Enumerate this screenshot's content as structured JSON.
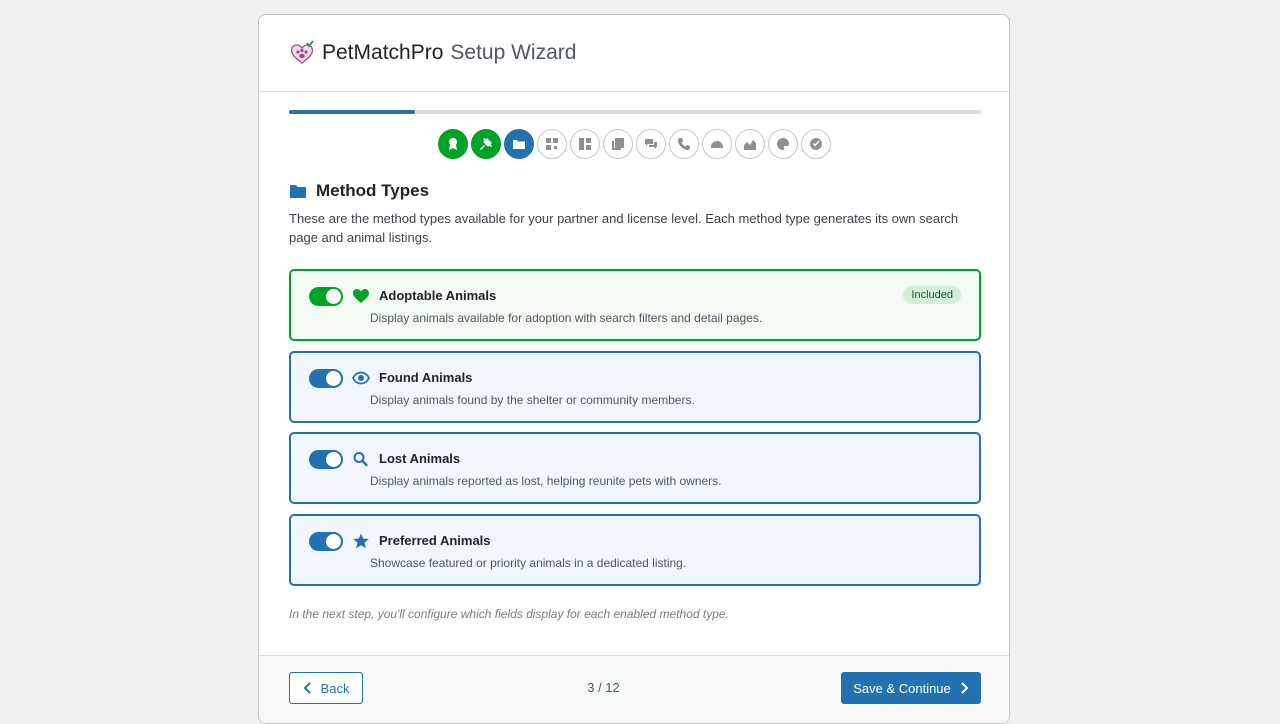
{
  "header": {
    "brand": "PetMatchPro",
    "subtitle": "Setup Wizard"
  },
  "progress": {
    "fraction": 0.1818,
    "current_step": 3,
    "total_steps": 12,
    "steps": [
      {
        "icon": "award-icon",
        "status": "done"
      },
      {
        "icon": "plug-icon",
        "status": "done"
      },
      {
        "icon": "folder-icon",
        "status": "current"
      },
      {
        "icon": "grid-icon",
        "status": "pending"
      },
      {
        "icon": "layout-icon",
        "status": "pending"
      },
      {
        "icon": "pages-icon",
        "status": "pending"
      },
      {
        "icon": "chat-icon",
        "status": "pending"
      },
      {
        "icon": "phone-icon",
        "status": "pending"
      },
      {
        "icon": "dashboard-icon",
        "status": "pending"
      },
      {
        "icon": "chart-icon",
        "status": "pending"
      },
      {
        "icon": "palette-icon",
        "status": "pending"
      },
      {
        "icon": "check-icon",
        "status": "pending"
      }
    ]
  },
  "section": {
    "title": "Method Types",
    "intro": "These are the method types available for your partner and license level. Each method type generates its own search page and animal listings."
  },
  "methods": [
    {
      "title": "Adoptable Animals",
      "description": "Display animals available for adoption with search filters and detail pages.",
      "icon": "heart-icon",
      "enabled": true,
      "badge": "Included"
    },
    {
      "title": "Found Animals",
      "description": "Display animals found by the shelter or community members.",
      "icon": "eye-icon",
      "enabled": true
    },
    {
      "title": "Lost Animals",
      "description": "Display animals reported as lost, helping reunite pets with owners.",
      "icon": "search-icon",
      "enabled": true
    },
    {
      "title": "Preferred Animals",
      "description": "Showcase featured or priority animals in a dedicated listing.",
      "icon": "star-icon",
      "enabled": true
    }
  ],
  "note": "In the next step, you'll configure which fields display for each enabled method type.",
  "footer": {
    "back_label": "Back",
    "page_count": "3 / 12",
    "next_label": "Save & Continue"
  },
  "colors": {
    "accent": "#2271b1",
    "success": "#00a32a"
  }
}
